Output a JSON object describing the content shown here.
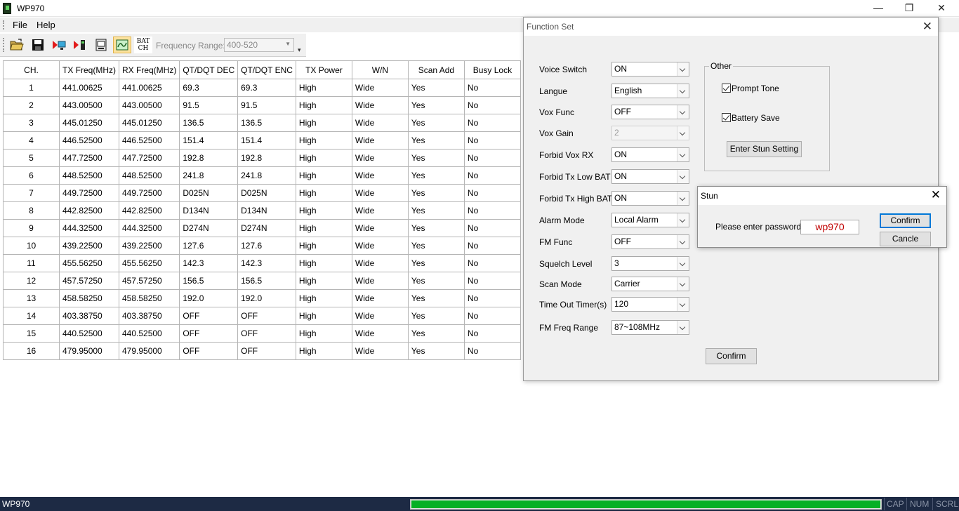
{
  "window": {
    "title": "WP970",
    "controls": {
      "minimize": "—",
      "restore": "❐",
      "close": "✕"
    }
  },
  "menu": [
    "File",
    "Help"
  ],
  "toolbar": {
    "batch_label_line1": "BAT",
    "batch_label_line2": "CH",
    "frequency_range_label": "Frequency Range:",
    "frequency_range_value": "400-520",
    "overflow": "▾"
  },
  "table": {
    "headers": [
      "CH.",
      "TX Freq(MHz)",
      "RX Freq(MHz)",
      "QT/DQT DEC",
      "QT/DQT ENC",
      "TX Power",
      "W/N",
      "Scan Add",
      "Busy Lock"
    ],
    "rows": [
      [
        "1",
        "441.00625",
        "441.00625",
        "69.3",
        "69.3",
        "High",
        "Wide",
        "Yes",
        "No"
      ],
      [
        "2",
        "443.00500",
        "443.00500",
        "91.5",
        "91.5",
        "High",
        "Wide",
        "Yes",
        "No"
      ],
      [
        "3",
        "445.01250",
        "445.01250",
        "136.5",
        "136.5",
        "High",
        "Wide",
        "Yes",
        "No"
      ],
      [
        "4",
        "446.52500",
        "446.52500",
        "151.4",
        "151.4",
        "High",
        "Wide",
        "Yes",
        "No"
      ],
      [
        "5",
        "447.72500",
        "447.72500",
        "192.8",
        "192.8",
        "High",
        "Wide",
        "Yes",
        "No"
      ],
      [
        "6",
        "448.52500",
        "448.52500",
        "241.8",
        "241.8",
        "High",
        "Wide",
        "Yes",
        "No"
      ],
      [
        "7",
        "449.72500",
        "449.72500",
        "D025N",
        "D025N",
        "High",
        "Wide",
        "Yes",
        "No"
      ],
      [
        "8",
        "442.82500",
        "442.82500",
        "D134N",
        "D134N",
        "High",
        "Wide",
        "Yes",
        "No"
      ],
      [
        "9",
        "444.32500",
        "444.32500",
        "D274N",
        "D274N",
        "High",
        "Wide",
        "Yes",
        "No"
      ],
      [
        "10",
        "439.22500",
        "439.22500",
        "127.6",
        "127.6",
        "High",
        "Wide",
        "Yes",
        "No"
      ],
      [
        "11",
        "455.56250",
        "455.56250",
        "142.3",
        "142.3",
        "High",
        "Wide",
        "Yes",
        "No"
      ],
      [
        "12",
        "457.57250",
        "457.57250",
        "156.5",
        "156.5",
        "High",
        "Wide",
        "Yes",
        "No"
      ],
      [
        "13",
        "458.58250",
        "458.58250",
        "192.0",
        "192.0",
        "High",
        "Wide",
        "Yes",
        "No"
      ],
      [
        "14",
        "403.38750",
        "403.38750",
        "OFF",
        "OFF",
        "High",
        "Wide",
        "Yes",
        "No"
      ],
      [
        "15",
        "440.52500",
        "440.52500",
        "OFF",
        "OFF",
        "High",
        "Wide",
        "Yes",
        "No"
      ],
      [
        "16",
        "479.95000",
        "479.95000",
        "OFF",
        "OFF",
        "High",
        "Wide",
        "Yes",
        "No"
      ]
    ]
  },
  "function_set": {
    "title": "Function Set",
    "close": "✕",
    "fields": [
      {
        "label": "Voice Switch",
        "value": "ON",
        "enabled": true
      },
      {
        "label": "Langue",
        "value": "English",
        "enabled": true
      },
      {
        "label": "Vox Func",
        "value": "OFF",
        "enabled": true
      },
      {
        "label": "Vox Gain",
        "value": "2",
        "enabled": false
      },
      {
        "label": "Forbid Vox RX",
        "value": "ON",
        "enabled": true
      },
      {
        "label": "Forbid Tx Low BAT",
        "value": "ON",
        "enabled": true
      },
      {
        "label": "Forbid Tx High BAT",
        "value": "ON",
        "enabled": true
      },
      {
        "label": "Alarm Mode",
        "value": "Local Alarm",
        "enabled": true
      },
      {
        "label": "FM Func",
        "value": "OFF",
        "enabled": true
      },
      {
        "label": "Squelch Level",
        "value": "3",
        "enabled": true
      },
      {
        "label": "Scan Mode",
        "value": "Carrier",
        "enabled": true
      },
      {
        "label": "Time Out Timer(s)",
        "value": "120",
        "enabled": true
      },
      {
        "label": "FM Freq Range",
        "value": "87~108MHz",
        "enabled": true
      }
    ],
    "other": {
      "title": "Other",
      "prompt_tone": {
        "label": "Prompt Tone",
        "checked": true
      },
      "battery_save": {
        "label": "Battery Save",
        "checked": true
      },
      "enter_stun_label": "Enter Stun Setting"
    },
    "confirm_label": "Confirm"
  },
  "stun": {
    "title": "Stun",
    "close": "✕",
    "prompt": "Please enter password:",
    "password": "wp970",
    "confirm_label": "Confirm",
    "cancel_label": "Cancle"
  },
  "status": {
    "text": "WP970",
    "progress": 1.0,
    "progress_color": "#06b025",
    "indicators": [
      "CAP",
      "NUM",
      "SCRL"
    ]
  },
  "colors": {
    "statusbar_bg": "#1d2a44",
    "password_text": "#c00000",
    "active_tool": "#fbe29e"
  }
}
